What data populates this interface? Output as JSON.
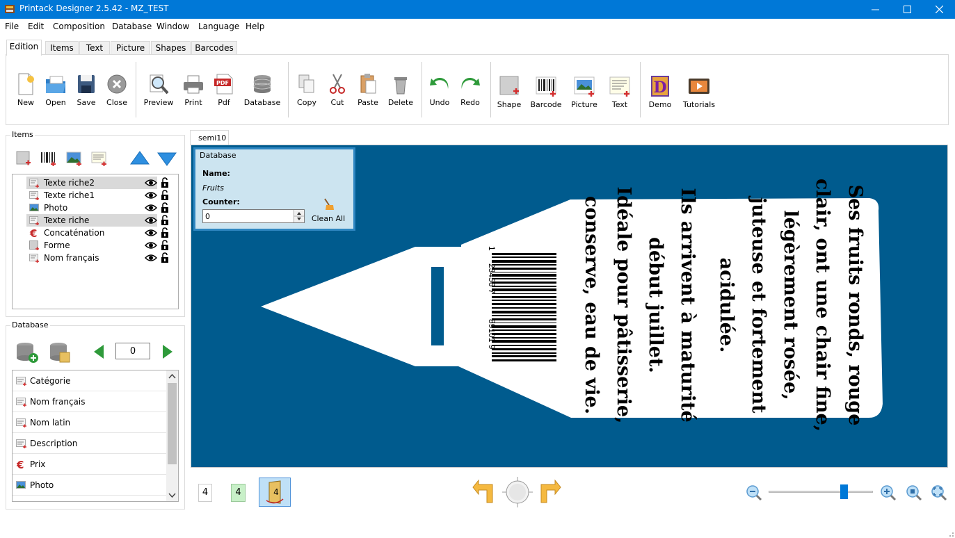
{
  "window": {
    "title": "Printack Designer 2.5.42 - MZ_TEST",
    "minimize": "minimize",
    "maximize": "maximize",
    "close": "close"
  },
  "menu": [
    "File",
    "Edit",
    "Composition",
    "Database",
    "Window",
    "Language",
    "Help"
  ],
  "ribbon_tabs": [
    "Edition",
    "Items",
    "Text",
    "Picture",
    "Shapes",
    "Barcodes"
  ],
  "toolbar": {
    "new": "New",
    "open": "Open",
    "save": "Save",
    "close": "Close",
    "preview": "Preview",
    "print": "Print",
    "pdf": "Pdf",
    "database": "Database",
    "copy": "Copy",
    "cut": "Cut",
    "paste": "Paste",
    "delete": "Delete",
    "undo": "Undo",
    "redo": "Redo",
    "shape": "Shape",
    "barcode": "Barcode",
    "picture": "Picture",
    "text": "Text",
    "demo": "Demo",
    "tutorials": "Tutorials",
    "pdf_badge": "PDF"
  },
  "items_panel": {
    "title": "Items",
    "items": [
      {
        "label": "Texte riche2",
        "icon": "rich-text-icon",
        "selected": true
      },
      {
        "label": "Texte riche1",
        "icon": "rich-text-icon",
        "selected": false
      },
      {
        "label": "Photo",
        "icon": "photo-icon",
        "selected": false
      },
      {
        "label": "Texte riche",
        "icon": "rich-text-icon",
        "selected": true
      },
      {
        "label": "Concaténation",
        "icon": "euro-icon",
        "selected": false
      },
      {
        "label": "Forme",
        "icon": "shape-icon",
        "selected": false
      },
      {
        "label": "Nom français",
        "icon": "rich-text-icon",
        "selected": false
      }
    ]
  },
  "database_panel": {
    "title": "Database",
    "record": "0",
    "fields": [
      {
        "label": "Catégorie",
        "icon": "text-field-icon"
      },
      {
        "label": "Nom français",
        "icon": "text-field-icon"
      },
      {
        "label": "Nom latin",
        "icon": "text-field-icon"
      },
      {
        "label": "Description",
        "icon": "text-field-icon"
      },
      {
        "label": "Prix",
        "icon": "euro-icon"
      },
      {
        "label": "Photo",
        "icon": "photo-icon"
      }
    ]
  },
  "document": {
    "tab": "semi10",
    "db_overlay": {
      "title": "Database",
      "name_label": "Name:",
      "name_value": "Fruits",
      "counter_label": "Counter:",
      "counter_value": "0",
      "clean_all": "Clean All"
    },
    "label_text_lines": [
      "Ses fruits ronds, rouge",
      "clair, ont une chair fine,",
      "légèrement rosée,",
      "juteuse et fortement",
      "acidulée.",
      "Ils arrivent à maturité",
      "début juillet.",
      "Idéale pour pâtisserie,",
      "conserve, eau de vie."
    ],
    "barcode_digits": {
      "first": "1",
      "left": "23456 7",
      "right": "89101 9"
    }
  },
  "bottom": {
    "page_count": "4",
    "page_current": "4",
    "page_icon_num": "4",
    "zoom_level": 0.72
  },
  "colors": {
    "titlebar": "#0078d7",
    "canvas": "#005b8e",
    "overlay_bg": "#cce4f0",
    "overlay_border": "#2e86c1"
  }
}
